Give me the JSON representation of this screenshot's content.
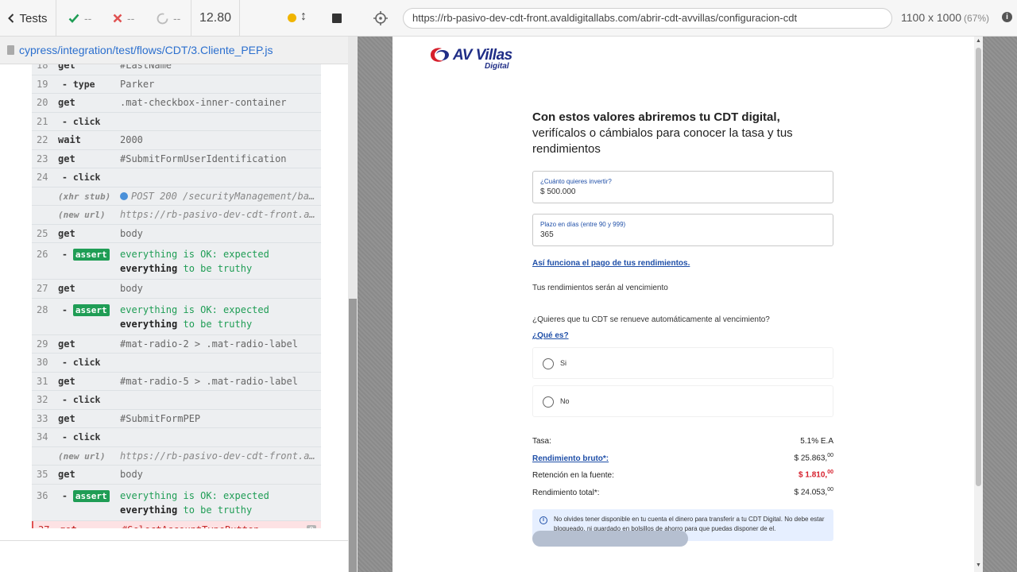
{
  "topbar": {
    "tests_label": "Tests",
    "passed": "--",
    "failed": "--",
    "pending": "--",
    "timer": "12.80",
    "url": "https://rb-pasivo-dev-cdt-front.avaldigitallabs.com/abrir-cdt-avvillas/configuracion-cdt",
    "viewport": "1100 x 1000",
    "scale": "(67%)",
    "info_glyph": "i",
    "updown_glyph": "↕",
    "colors": {
      "passed": "#1f9d55",
      "failed": "#e05252",
      "running": "#f0b400"
    }
  },
  "spec": {
    "file_path": "cypress/integration/test/flows/CDT/3.Cliente_PEP.js"
  },
  "commands": [
    {
      "num": "18",
      "cmd": "get",
      "msg": "#LastName",
      "kind": "normal"
    },
    {
      "num": "19",
      "cmd": "- type",
      "msg": "Parker",
      "kind": "sub"
    },
    {
      "num": "20",
      "cmd": "get",
      "msg": ".mat-checkbox-inner-container",
      "kind": "normal"
    },
    {
      "num": "21",
      "cmd": "- click",
      "msg": "",
      "kind": "sub"
    },
    {
      "num": "22",
      "cmd": "wait",
      "msg": "2000",
      "kind": "normal"
    },
    {
      "num": "23",
      "cmd": "get",
      "msg": "#SubmitFormUserIdentification",
      "kind": "normal"
    },
    {
      "num": "24",
      "cmd": "- click",
      "msg": "",
      "kind": "sub"
    },
    {
      "num": "",
      "cmd": "(xhr stub)",
      "msg": "POST 200 /securityManagement/ba...",
      "kind": "xhr"
    },
    {
      "num": "",
      "cmd": "(new url)",
      "msg": "https://rb-pasivo-dev-cdt-front.a...",
      "kind": "url"
    },
    {
      "num": "25",
      "cmd": "get",
      "msg": "body",
      "kind": "normal"
    },
    {
      "num": "26",
      "cmd": "assert",
      "msg_pre": "everything is OK: expected",
      "msg_bold": "everything",
      "msg_post": "to be truthy",
      "kind": "assert"
    },
    {
      "num": "27",
      "cmd": "get",
      "msg": "body",
      "kind": "normal"
    },
    {
      "num": "28",
      "cmd": "assert",
      "msg_pre": "everything is OK: expected",
      "msg_bold": "everything",
      "msg_post": "to be truthy",
      "kind": "assert"
    },
    {
      "num": "29",
      "cmd": "get",
      "msg": "#mat-radio-2 > .mat-radio-label",
      "kind": "normal"
    },
    {
      "num": "30",
      "cmd": "- click",
      "msg": "",
      "kind": "sub"
    },
    {
      "num": "31",
      "cmd": "get",
      "msg": "#mat-radio-5 > .mat-radio-label",
      "kind": "normal"
    },
    {
      "num": "32",
      "cmd": "- click",
      "msg": "",
      "kind": "sub"
    },
    {
      "num": "33",
      "cmd": "get",
      "msg": "#SubmitFormPEP",
      "kind": "normal"
    },
    {
      "num": "34",
      "cmd": "- click",
      "msg": "",
      "kind": "sub"
    },
    {
      "num": "",
      "cmd": "(new url)",
      "msg": "https://rb-pasivo-dev-cdt-front.a...",
      "kind": "url"
    },
    {
      "num": "35",
      "cmd": "get",
      "msg": "body",
      "kind": "normal"
    },
    {
      "num": "36",
      "cmd": "assert",
      "msg_pre": "everything is OK: expected",
      "msg_bold": "everything",
      "msg_post": "to be truthy",
      "kind": "assert"
    },
    {
      "num": "37",
      "cmd": "get",
      "msg": "#SelectAccountTypeButton",
      "kind": "failing",
      "badge": "0"
    }
  ],
  "aut": {
    "logo": {
      "brand": "AV Villas",
      "sub": "Digital"
    },
    "heading_bold": "Con estos valores abriremos tu CDT digital,",
    "heading_rest": "verifícalos o cámbialos para conocer la tasa y tus rendimientos",
    "fields": {
      "amount": {
        "label": "¿Cuánto quieres invertir?",
        "value": "$ 500.000"
      },
      "term": {
        "label": "Plazo en días (entre 90 y 999)",
        "value": "365"
      }
    },
    "payment_link": "Así funciona el pago de tus rendimientos.",
    "payment_text": "Tus rendimientos serán al vencimiento",
    "renew_question": "¿Quieres que tu CDT se renueve automáticamente al vencimiento?",
    "what_is_link": "¿Qué es?",
    "options": [
      "Si",
      "No"
    ],
    "summary": {
      "rate": {
        "label": "Tasa:",
        "value": "5.1% E.A"
      },
      "gross": {
        "label": "Rendimiento bruto*:",
        "value": "$ 25.863,",
        "cents": "00"
      },
      "withholding": {
        "label": "Retención en la fuente:",
        "value": "$ 1.810,",
        "cents": "00"
      },
      "total": {
        "label": "Rendimiento total*:",
        "value": "$ 24.053,",
        "cents": "00"
      }
    },
    "notice": "No olvides tener disponible en tu cuenta el dinero para transferir a tu CDT Digital. No debe estar bloqueado, ni guardado en bolsillos de ahorro para que puedas disponer de el.",
    "notice_icon_glyph": "i",
    "colors": {
      "brand_blue": "#1f2d86",
      "link_blue": "#1f4fa8",
      "negative_red": "#d61f2c",
      "notice_bg": "#e6efff"
    }
  }
}
